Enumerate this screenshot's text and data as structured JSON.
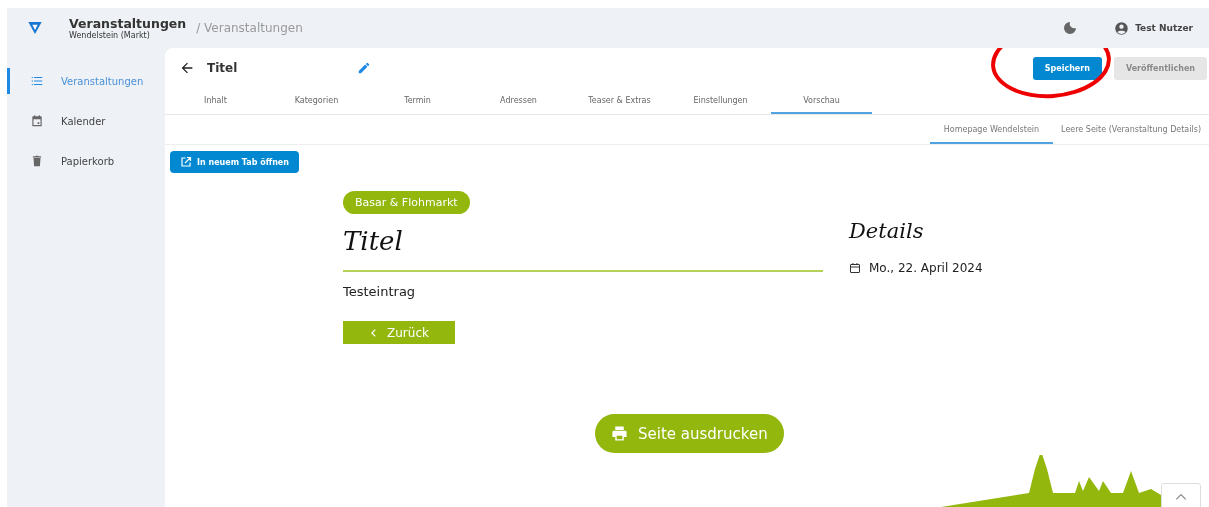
{
  "header": {
    "app_title": "Veranstaltungen",
    "app_subtitle": "Wendelstein (Markt)",
    "breadcrumb": "/ Veranstaltungen",
    "user_name": "Test Nutzer"
  },
  "sidebar": {
    "items": [
      {
        "label": "Veranstaltungen",
        "selected": true
      },
      {
        "label": "Kalender",
        "selected": false
      },
      {
        "label": "Papierkorb",
        "selected": false
      }
    ]
  },
  "editor": {
    "title": "Titel",
    "buttons": [
      {
        "label": "Speichern",
        "disabled": false
      },
      {
        "label": "Veröffentlichen",
        "disabled": true
      }
    ],
    "tabs": [
      {
        "label": "Inhalt",
        "selected": false
      },
      {
        "label": "Kategorien",
        "selected": false
      },
      {
        "label": "Termin",
        "selected": false
      },
      {
        "label": "Adressen",
        "selected": false
      },
      {
        "label": "Teaser & Extras",
        "selected": false
      },
      {
        "label": "Einstellungen",
        "selected": false
      },
      {
        "label": "Vorschau",
        "selected": true
      }
    ],
    "preview_tabs": [
      {
        "label": "Homepage Wendelstein",
        "selected": true
      },
      {
        "label": "Leere Seite (Veranstaltung Details)",
        "selected": false
      }
    ],
    "open_button": "In neuem Tab öffnen"
  },
  "preview": {
    "category": "Basar & Flohmarkt",
    "title": "Titel",
    "text": "Testeintrag",
    "back_button": "Zurück",
    "details_heading": "Details",
    "date": "Mo., 22. April 2024",
    "print_button": "Seite ausdrucken"
  }
}
